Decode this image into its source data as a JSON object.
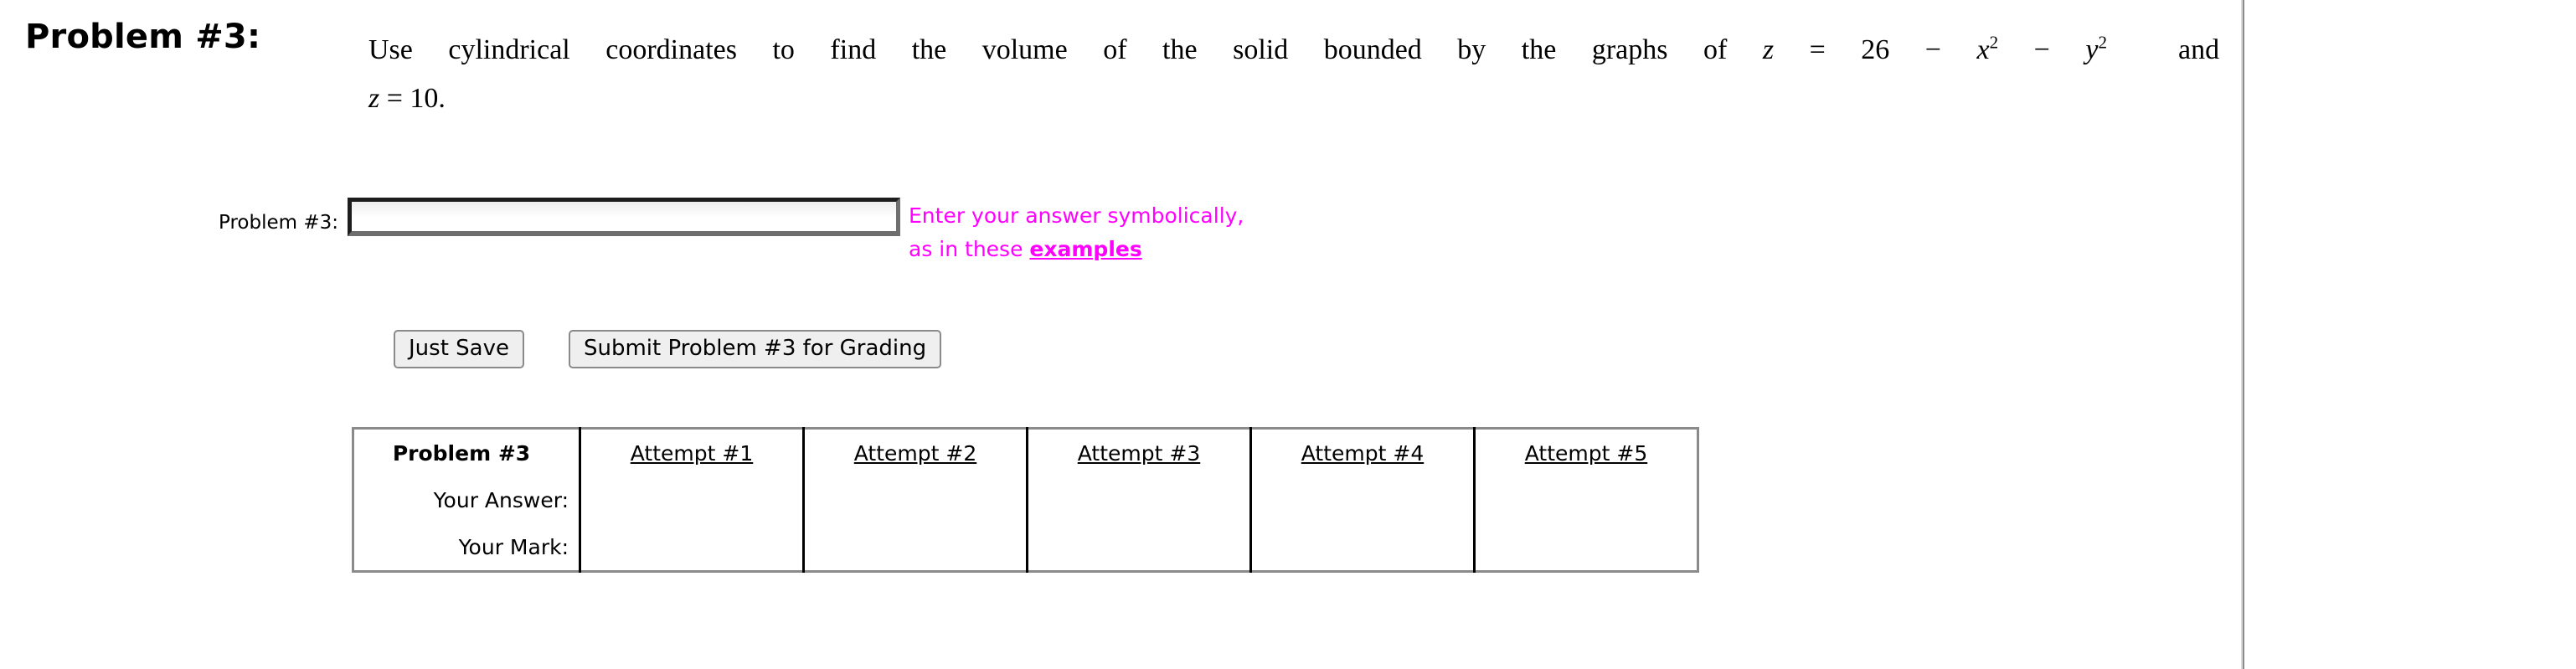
{
  "problem": {
    "heading": "Problem #3:",
    "line1_prefix": "Use cylindrical coordinates to find the volume of the solid bounded by the graphs of ",
    "equation1": {
      "lhs": "z",
      "eq": "=",
      "rhs_const": "26",
      "minus1": "−",
      "term1_base": "x",
      "term1_exp": "2",
      "minus2": "−",
      "term2_base": "y",
      "term2_exp": "2"
    },
    "line1_suffix": "and",
    "equation2": {
      "lhs": "z",
      "eq": "=",
      "rhs": "10."
    }
  },
  "answer_section": {
    "label": "Problem #3:",
    "input_value": "",
    "input_placeholder": "",
    "hint_line1": "Enter your answer symbolically,",
    "hint_line2_prefix": "as in these ",
    "hint_link": "examples",
    "hint_color": "#ff00ff"
  },
  "buttons": {
    "just_save": "Just Save",
    "submit_grading": "Submit Problem #3 for Grading"
  },
  "attempts_table": {
    "corner_header": "Problem #3",
    "row_labels": [
      "Your Answer:",
      "Your Mark:"
    ],
    "columns": [
      "Attempt #1",
      "Attempt #2",
      "Attempt #3",
      "Attempt #4",
      "Attempt #5"
    ],
    "rows": [
      [
        "",
        "",
        "",
        "",
        ""
      ],
      [
        "",
        "",
        "",
        "",
        ""
      ]
    ]
  }
}
